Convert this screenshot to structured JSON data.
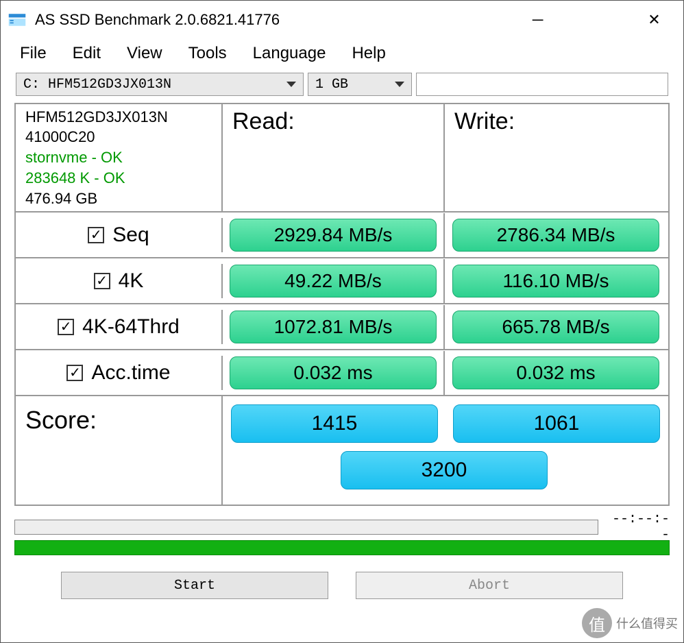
{
  "window": {
    "title": "AS SSD Benchmark 2.0.6821.41776"
  },
  "menu": {
    "file": "File",
    "edit": "Edit",
    "view": "View",
    "tools": "Tools",
    "language": "Language",
    "help": "Help"
  },
  "selectors": {
    "drive": "C: HFM512GD3JX013N",
    "size": "1 GB"
  },
  "device": {
    "model": "HFM512GD3JX013N",
    "firmware": "41000C20",
    "driver_status": "stornvme - OK",
    "alignment_status": "283648 K - OK",
    "capacity": "476.94 GB"
  },
  "headers": {
    "read": "Read:",
    "write": "Write:",
    "score": "Score:"
  },
  "tests": {
    "seq": {
      "label": "Seq",
      "read": "2929.84 MB/s",
      "write": "2786.34 MB/s"
    },
    "fourk": {
      "label": "4K",
      "read": "49.22 MB/s",
      "write": "116.10 MB/s"
    },
    "fourk64": {
      "label": "4K-64Thrd",
      "read": "1072.81 MB/s",
      "write": "665.78 MB/s"
    },
    "acc": {
      "label": "Acc.time",
      "read": "0.032 ms",
      "write": "0.032 ms"
    }
  },
  "score": {
    "read": "1415",
    "write": "1061",
    "total": "3200"
  },
  "status": {
    "time": "--:--:--"
  },
  "buttons": {
    "start": "Start",
    "abort": "Abort"
  },
  "watermark": {
    "icon_text": "值",
    "text": "什么值得买"
  }
}
